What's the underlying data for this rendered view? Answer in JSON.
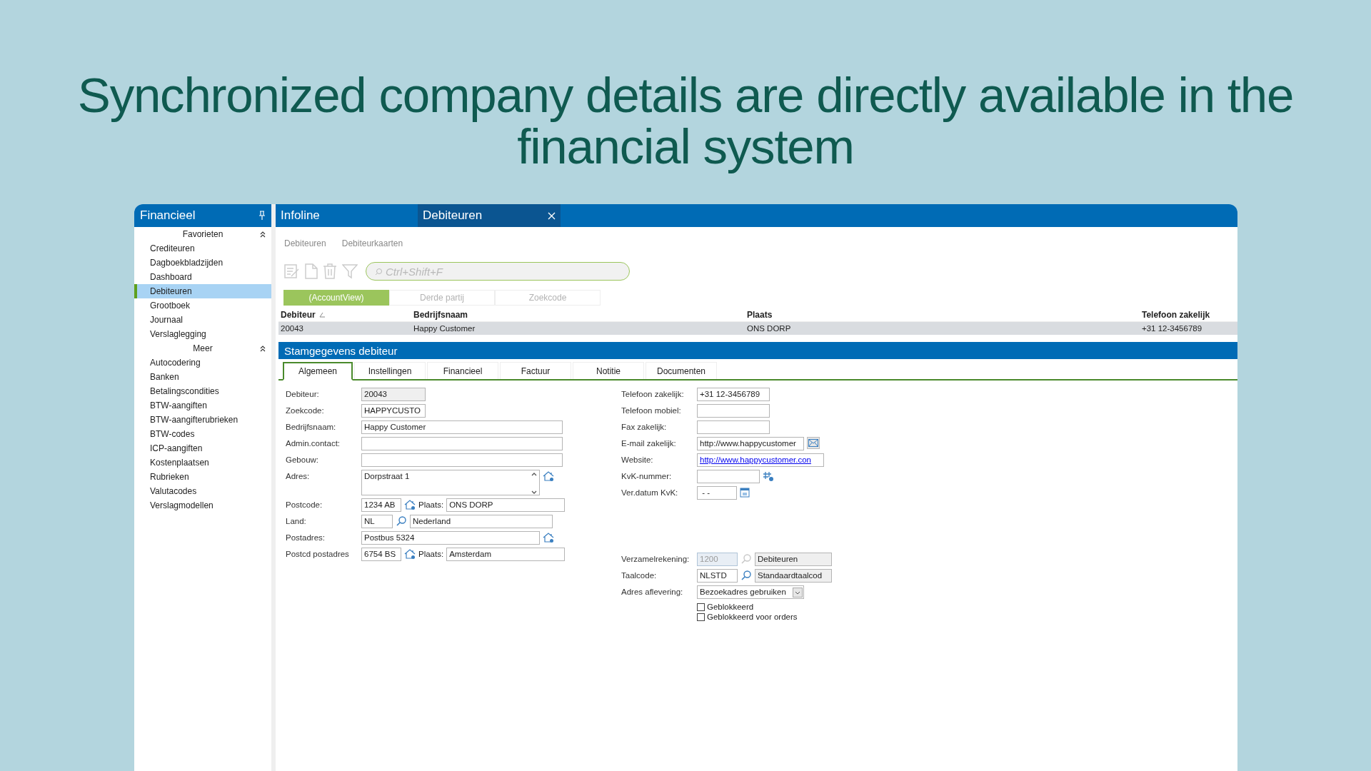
{
  "heading": "Synchronized company details are directly available in the financial system",
  "sidebar": {
    "title": "Financieel",
    "sections": [
      {
        "title": "Favorieten",
        "expanded": true,
        "items": [
          {
            "label": "Crediteuren",
            "selected": false
          },
          {
            "label": "Dagboekbladzijden",
            "selected": false
          },
          {
            "label": "Dashboard",
            "selected": false
          },
          {
            "label": "Debiteuren",
            "selected": true
          },
          {
            "label": "Grootboek",
            "selected": false
          },
          {
            "label": "Journaal",
            "selected": false
          },
          {
            "label": "Verslaglegging",
            "selected": false
          }
        ]
      },
      {
        "title": "Meer",
        "expanded": true,
        "items": [
          {
            "label": "Autocodering",
            "selected": false
          },
          {
            "label": "Banken",
            "selected": false
          },
          {
            "label": "Betalingscondities",
            "selected": false
          },
          {
            "label": "BTW-aangiften",
            "selected": false
          },
          {
            "label": "BTW-aangifterubrieken",
            "selected": false
          },
          {
            "label": "BTW-codes",
            "selected": false
          },
          {
            "label": "ICP-aangiften",
            "selected": false
          },
          {
            "label": "Kostenplaatsen",
            "selected": false
          },
          {
            "label": "Rubrieken",
            "selected": false
          },
          {
            "label": "Valutacodes",
            "selected": false
          },
          {
            "label": "Verslagmodellen",
            "selected": false
          }
        ]
      }
    ]
  },
  "app_tabs": [
    {
      "label": "Infoline",
      "selected": false,
      "closable": false
    },
    {
      "label": "Debiteuren",
      "selected": true,
      "closable": true
    }
  ],
  "breadcrumbs": [
    "Debiteuren",
    "Debiteurkaarten"
  ],
  "search": {
    "placeholder": "Ctrl+Shift+F"
  },
  "views": [
    {
      "label": "(AccountView)",
      "selected": true
    },
    {
      "label": "Derde partij",
      "selected": false
    },
    {
      "label": "Zoekcode",
      "selected": false
    }
  ],
  "table": {
    "columns": [
      {
        "label": "Debiteur",
        "sorted": true
      },
      {
        "label": "Bedrijfsnaam",
        "sorted": false
      },
      {
        "label": "Plaats",
        "sorted": false
      },
      {
        "label": "Telefoon zakelijk",
        "sorted": false
      }
    ],
    "rows": [
      {
        "selected": true,
        "cells": [
          "20043",
          "Happy Customer",
          "ONS DORP",
          "+31 12-3456789"
        ]
      }
    ]
  },
  "section_title": "Stamgegevens debiteur",
  "form_tabs": [
    {
      "label": "Algemeen",
      "selected": true
    },
    {
      "label": "Instellingen",
      "selected": false
    },
    {
      "label": "Financieel",
      "selected": false
    },
    {
      "label": "Factuur",
      "selected": false
    },
    {
      "label": "Notitie",
      "selected": false
    },
    {
      "label": "Documenten",
      "selected": false
    }
  ],
  "left_fields": [
    {
      "kind": "code",
      "label": "Debiteur:",
      "value": "20043",
      "readonly": true
    },
    {
      "kind": "code",
      "label": "Zoekcode:",
      "value": "HAPPYCUSTO",
      "readonly": false
    },
    {
      "kind": "text",
      "label": "Bedrijfsnaam:",
      "value": "Happy Customer"
    },
    {
      "kind": "text",
      "label": "Admin.contact:"
    },
    {
      "kind": "text",
      "label": "Gebouw:"
    },
    {
      "kind": "address",
      "label": "Adres:",
      "value": "Dorpstraat 1"
    },
    {
      "kind": "postcode",
      "label": "Postcode:",
      "value": "1234 AB",
      "city_label": "Plaats:",
      "city": "ONS DORP"
    },
    {
      "kind": "lookup",
      "label": "Land:",
      "value": "NL",
      "name": "Nederland",
      "disabled": false,
      "name_readonly": false
    },
    {
      "kind": "street",
      "label": "Postadres:",
      "value": "Postbus 5324"
    },
    {
      "kind": "postcode",
      "label": "Postcd postadres",
      "value": "6754 BS",
      "city_label": "Plaats:",
      "city": "Amsterdam"
    }
  ],
  "contact_fields": [
    {
      "kind": "phone",
      "label": "Telefoon zakelijk:",
      "value": "+31 12-3456789"
    },
    {
      "kind": "phone",
      "label": "Telefoon mobiel:"
    },
    {
      "kind": "phone",
      "label": "Fax zakelijk:"
    },
    {
      "kind": "email",
      "label": "E-mail zakelijk:",
      "value": "http://www.happycustomer"
    },
    {
      "kind": "link",
      "label": "Website:",
      "value": "http://www.happycustomer.con"
    },
    {
      "kind": "number",
      "label": "KvK-nummer:"
    },
    {
      "kind": "date",
      "label": "Ver.datum KvK:",
      "value": "- -"
    }
  ],
  "account_fields": [
    {
      "kind": "lookup",
      "label": "Verzamelrekening:",
      "value": "1200",
      "name": "Debiteuren",
      "disabled": true,
      "name_readonly": true
    },
    {
      "kind": "lookup",
      "label": "Taalcode:",
      "value": "NLSTD",
      "name": "Standaardtaalcod",
      "disabled": false,
      "name_readonly": true
    },
    {
      "kind": "select",
      "label": "Adres aflevering:",
      "value": "Bezoekadres gebruiken"
    }
  ],
  "checkboxes": [
    {
      "label": "Geblokkeerd",
      "checked": false
    },
    {
      "label": "Geblokkeerd voor orders",
      "checked": false
    }
  ]
}
